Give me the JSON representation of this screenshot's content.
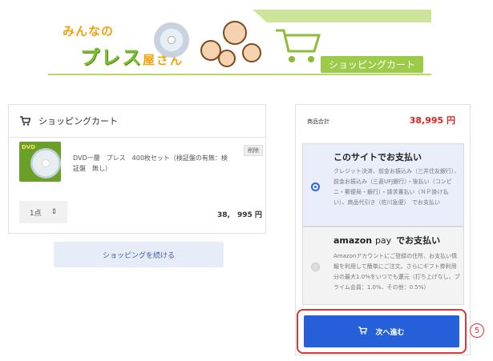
{
  "banner": {
    "logo_small": "みんなの",
    "logo_main": "プレス",
    "logo_suffix": "屋さん",
    "section_title": "ショッピングカート"
  },
  "cart": {
    "heading": "ショッピングカート",
    "thumb_label": "DVD",
    "item": {
      "name": "DVD一層　プレス　400枚セット（検証盤の有無：検証盤　無し）",
      "delete_label": "削除",
      "quantity": "1点",
      "price": "38,　995 円"
    },
    "continue_label": "ショッピングを続ける"
  },
  "summary": {
    "total_label": "商品合計",
    "total_value": "38,995 円",
    "options": [
      {
        "title": "このサイトでお支払い",
        "description": "クレジット決済、前金お振込み（三井住友銀行）、前金お振込み（三菱UFJ銀行）・後払い（コンビニ・郵便局・銀行）・請求書払い（ＮＰ掛け払い）、商品代引き（佐川急便）　でお支払い",
        "selected": true
      },
      {
        "title_brand": "amazon",
        "title_brand_suffix": "pay",
        "title": "でお支払い",
        "description": "Amazonアカウントにご登録の住所、お支払い情報を利用して簡単にご注文。さらにギフト券利用分の最大1.0%をいつでも還元（打ち上げなし、プライム会員：1.0%、その他：0.5%）",
        "selected": false
      }
    ],
    "next_label": "次へ進む",
    "step_marker": "5"
  },
  "colors": {
    "accent_blue": "#2560d8",
    "price_red": "#e0241f",
    "highlight_red": "#e23434",
    "brand_green": "#7cbf2e"
  }
}
